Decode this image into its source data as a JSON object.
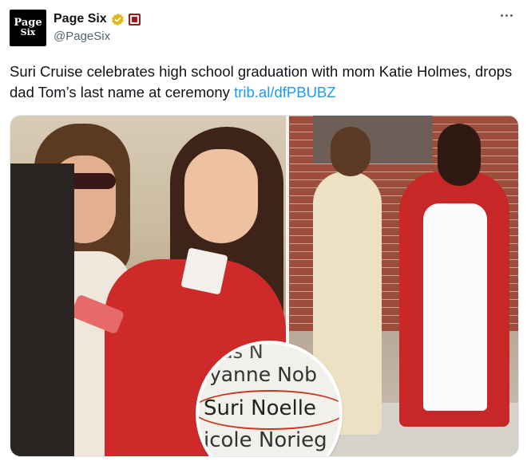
{
  "account": {
    "avatar_line1": "Page",
    "avatar_line2": "Six",
    "display_name": "Page Six",
    "handle": "@PageSix",
    "verified_color": "#e2b719",
    "affiliate_color": "#9b1b1f"
  },
  "tweet": {
    "text": "Suri Cruise celebrates high school graduation with mom Katie Holmes, drops dad Tom’s last name at ceremony ",
    "link": "trib.al/dfPBUBZ",
    "link_color": "#1d9bf0"
  },
  "media": {
    "inset_lines": [
      "ious N",
      "iyanne Nob",
      "Suri Noelle",
      "icole Norieg"
    ],
    "highlight_color": "#c8361d"
  },
  "icons": {
    "more": "more-options-icon",
    "verified": "verified-badge-icon",
    "affiliate": "affiliate-badge-icon"
  }
}
